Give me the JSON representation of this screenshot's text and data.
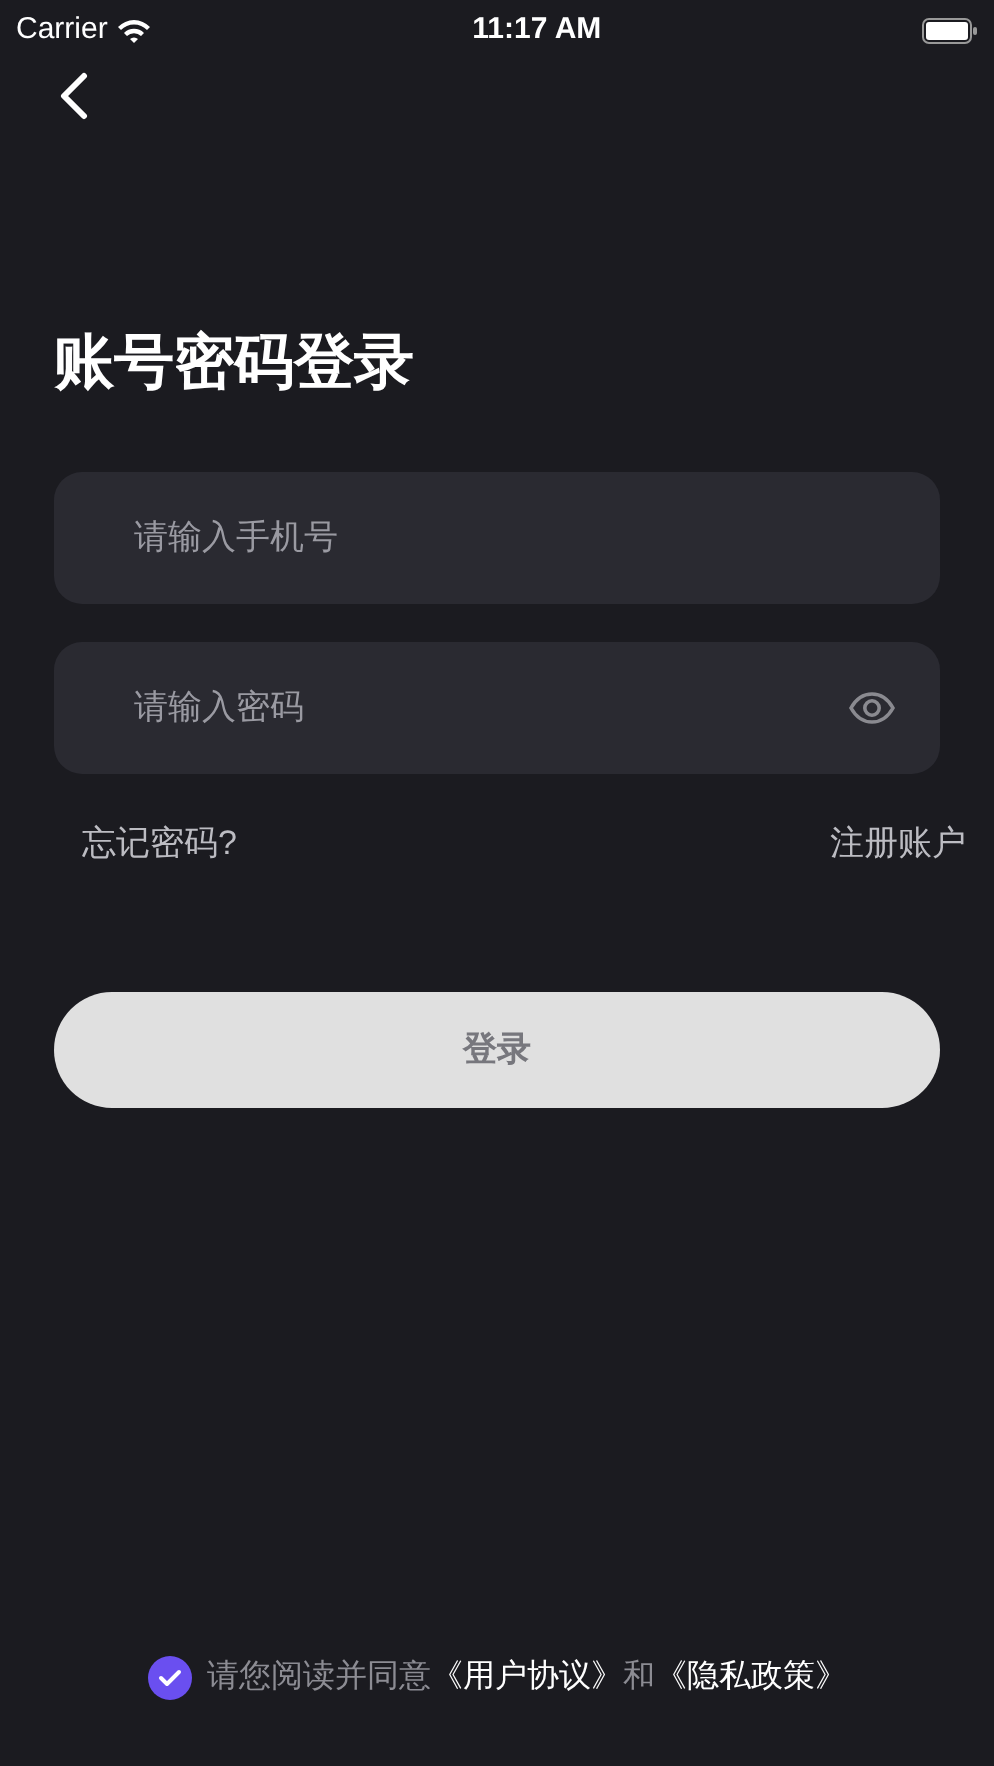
{
  "status_bar": {
    "carrier": "Carrier",
    "time": "11:17 AM"
  },
  "title": "账号密码登录",
  "fields": [
    {
      "kind": "phone",
      "placeholder": "请输入手机号"
    },
    {
      "kind": "password",
      "placeholder": "请输入密码"
    }
  ],
  "forgot_link": "忘记密码?",
  "register_link": "注册账户",
  "login_button": "登录",
  "agreement": {
    "checked": true,
    "parts": [
      {
        "kind": "text",
        "text": "请您阅读并同意"
      },
      {
        "kind": "link",
        "text": "《用户协议》"
      },
      {
        "kind": "text",
        "text": "和"
      },
      {
        "kind": "link",
        "text": "《隐私政策》"
      }
    ]
  }
}
